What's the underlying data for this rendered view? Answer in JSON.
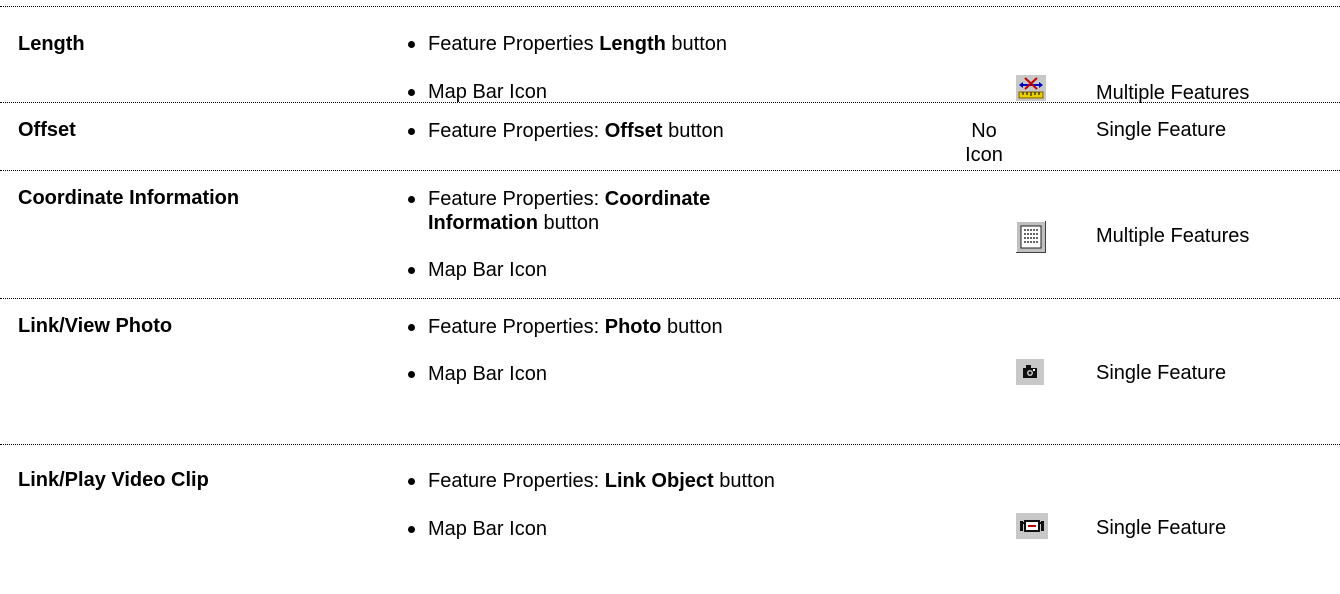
{
  "rows": [
    {
      "name": "Length",
      "access": [
        {
          "prefix": "Feature Properties ",
          "bold": "Length",
          "suffix": " button"
        },
        {
          "text": "Map Bar Icon"
        }
      ],
      "icon": "length-measure-icon",
      "scope": "Multiple Features"
    },
    {
      "name": "Offset",
      "access": [
        {
          "prefix": "Feature Properties: ",
          "bold": "Offset",
          "suffix": " button"
        }
      ],
      "icon_text": [
        "No",
        "Icon"
      ],
      "scope": "Single Feature"
    },
    {
      "name": "Coordinate Information",
      "access": [
        {
          "prefix": "Feature Properties: ",
          "bold": "Coordinate",
          "line2_bold": "Information",
          "suffix": " button"
        },
        {
          "text": "Map Bar Icon"
        }
      ],
      "icon": "coordinate-grid-icon",
      "scope": "Multiple Features"
    },
    {
      "name": "Link/View Photo",
      "access": [
        {
          "prefix": "Feature Properties: ",
          "bold": "Photo",
          "suffix": " button"
        },
        {
          "text": "Map Bar Icon"
        }
      ],
      "icon": "camera-icon",
      "scope": "Single Feature"
    },
    {
      "name": "Link/Play Video Clip",
      "access": [
        {
          "prefix": "Feature Properties: ",
          "bold": "Link Object",
          "suffix": " button"
        },
        {
          "text": "Map Bar Icon"
        }
      ],
      "icon": "video-camera-icon",
      "scope": "Single Feature"
    }
  ]
}
